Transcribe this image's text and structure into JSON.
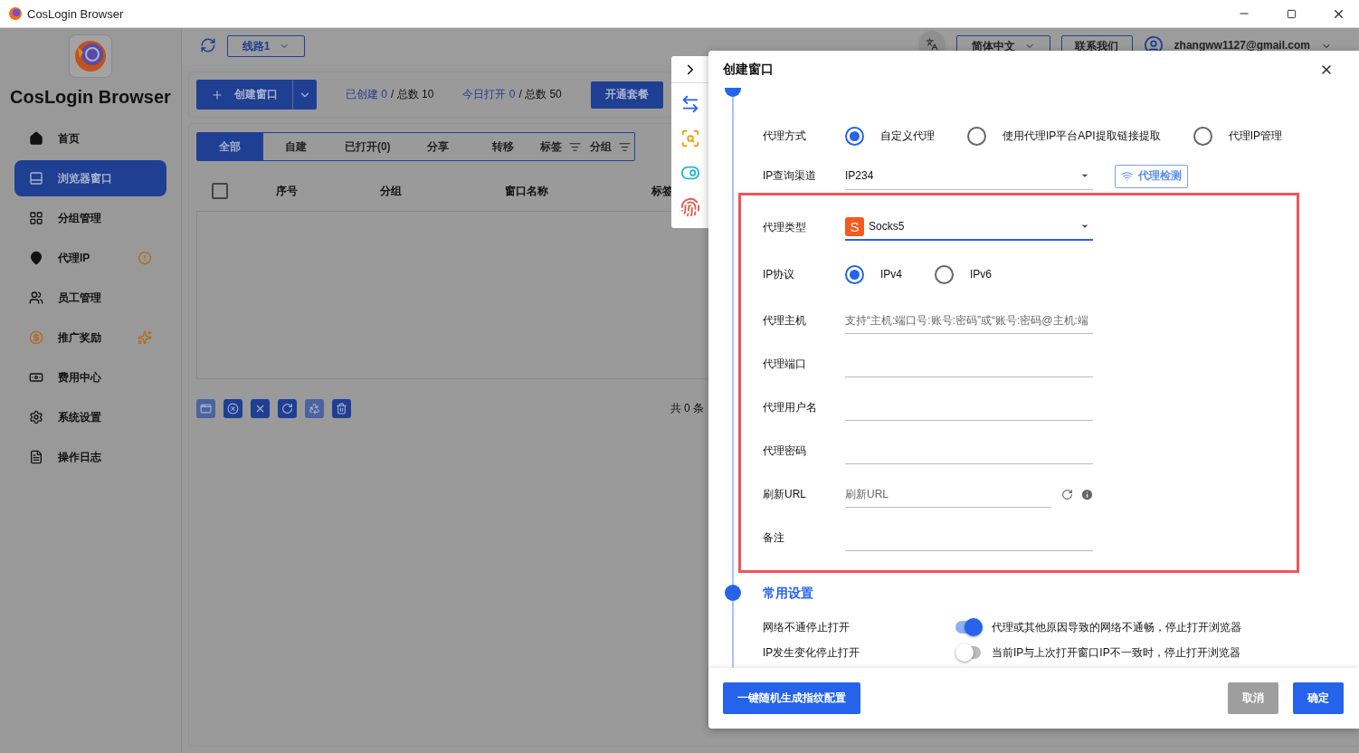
{
  "window": {
    "title": "CosLogin Browser"
  },
  "sidebar": {
    "brand": "CosLogin Browser",
    "items": [
      {
        "label": "首页",
        "selected": false
      },
      {
        "label": "浏览器窗口",
        "selected": true
      },
      {
        "label": "分组管理",
        "selected": false
      },
      {
        "label": "代理IP",
        "selected": false
      },
      {
        "label": "员工管理",
        "selected": false
      },
      {
        "label": "推广奖励",
        "selected": false
      },
      {
        "label": "费用中心",
        "selected": false
      },
      {
        "label": "系统设置",
        "selected": false
      },
      {
        "label": "操作日志",
        "selected": false
      }
    ]
  },
  "header": {
    "route": "线路1",
    "language": "简体中文",
    "contact": "联系我们",
    "account": "zhangww1127@gmail.com"
  },
  "summary": {
    "create_button": "创建窗口",
    "created": "已创建 0",
    "created_total": "/ 总数 10",
    "opened": "今日打开 0",
    "opened_total": "/ 总数 50",
    "plan_button": "开通套餐"
  },
  "filter_tabs": [
    {
      "kind": "plain",
      "label": "全部",
      "selected": true
    },
    {
      "kind": "plain",
      "label": "自建",
      "selected": false
    },
    {
      "kind": "plain",
      "label": "已打开(0)",
      "selected": false
    },
    {
      "kind": "plain",
      "label": "分享",
      "selected": false
    },
    {
      "kind": "plain",
      "label": "转移",
      "selected": false
    },
    {
      "kind": "sort",
      "label": "标签",
      "selected": false
    },
    {
      "kind": "sort",
      "label": "分组",
      "selected": false
    }
  ],
  "table": {
    "select_all": {
      "checked": false
    },
    "columns": [
      "序号",
      "分组",
      "窗口名称",
      "标签"
    ]
  },
  "actions": [
    {
      "disabled": true
    },
    {
      "disabled": false
    },
    {
      "disabled": false
    },
    {
      "disabled": false
    },
    {
      "disabled": true
    },
    {
      "disabled": false
    }
  ],
  "pager": {
    "total": "共 0 条"
  },
  "dialog": {
    "title": "创建窗口",
    "proxy": {
      "mode": {
        "label": "代理方式",
        "options": [
          {
            "label": "自定义代理",
            "selected": true
          },
          {
            "label": "使用代理IP平台API提取链接提取",
            "selected": false
          },
          {
            "label": "代理IP管理",
            "selected": false
          }
        ]
      },
      "ip_channel": {
        "label": "IP查询渠道",
        "value": "IP234",
        "check_button": "代理检测"
      },
      "fields": [
        {
          "kind": "select",
          "label": "代理类型",
          "badge": "S",
          "value": "Socks5",
          "focused": true
        },
        {
          "kind": "radio",
          "label": "IP协议",
          "options": [
            {
              "label": "IPv4",
              "selected": true
            },
            {
              "label": "IPv6",
              "selected": false
            }
          ]
        },
        {
          "kind": "input",
          "label": "代理主机",
          "placeholder": "支持“主机:端口号:账号:密码”或“账号:密码@主机:端"
        },
        {
          "kind": "input",
          "label": "代理端口"
        },
        {
          "kind": "input",
          "label": "代理用户名"
        },
        {
          "kind": "input",
          "label": "代理密码"
        },
        {
          "kind": "url",
          "label": "刷新URL",
          "placeholder": "刷新URL"
        },
        {
          "kind": "input",
          "label": "备注"
        }
      ]
    },
    "common": {
      "title": "常用设置",
      "settings": [
        {
          "label": "网络不通停止打开",
          "on": true,
          "description": "代理或其他原因导致的网络不通畅，停止打开浏览器"
        },
        {
          "label": "IP发生变化停止打开",
          "on": false,
          "description": "当前IP与上次打开窗口IP不一致时，停止打开浏览器"
        }
      ]
    },
    "buttons": {
      "random": "一键随机生成指纹配置",
      "cancel": "取消",
      "confirm": "确定"
    }
  }
}
